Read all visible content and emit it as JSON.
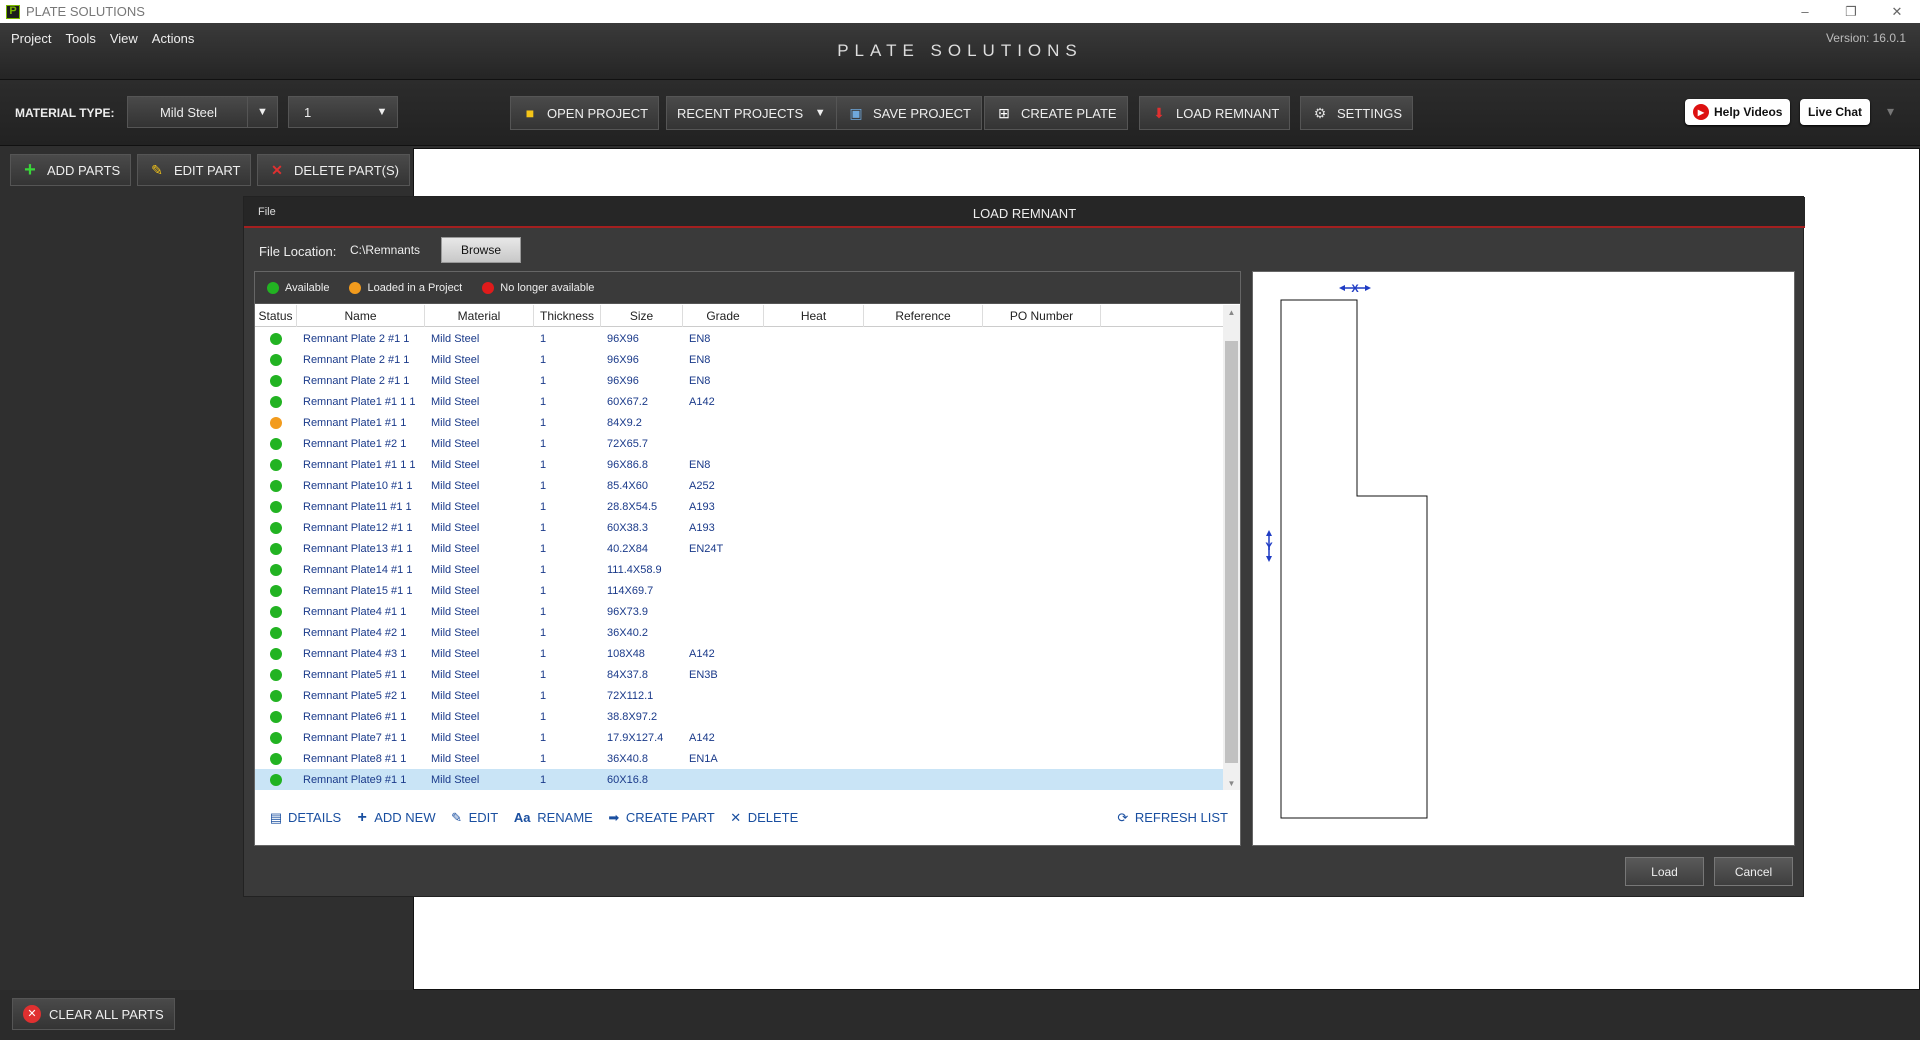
{
  "window": {
    "title": "PLATE SOLUTIONS",
    "controls": [
      "–",
      "❐",
      "✕"
    ]
  },
  "header": {
    "menu": [
      "Project",
      "Tools",
      "View",
      "Actions"
    ],
    "app_title": "PLATE SOLUTIONS",
    "version": "Version: 16.0.1"
  },
  "toolbar": {
    "material_type_label": "MATERIAL TYPE:",
    "material_value": "Mild Steel",
    "thickness_value": "1",
    "buttons": {
      "open_project": "OPEN PROJECT",
      "recent_projects": "RECENT PROJECTS",
      "save_project": "SAVE PROJECT",
      "create_plate": "CREATE PLATE",
      "load_remnant": "LOAD REMNANT",
      "settings": "SETTINGS"
    },
    "help_videos": "Help Videos",
    "live_chat": "Live Chat"
  },
  "left_panel": {
    "add_parts": "ADD PARTS",
    "edit_part": "EDIT PART",
    "delete_parts": "DELETE PART(S)",
    "clear_all_parts": "CLEAR ALL PARTS"
  },
  "dialog": {
    "menu_file": "File",
    "title": "LOAD REMNANT",
    "file_location_label": "File Location:",
    "file_location_value": "C:\\Remnants",
    "browse": "Browse",
    "legend": {
      "available": "Available",
      "loaded": "Loaded in a Project",
      "unavailable": "No longer available"
    },
    "colors": {
      "available": "#22b322",
      "loaded": "#f29b1d",
      "unavailable": "#e01b1b"
    },
    "columns": [
      "Status",
      "Name",
      "Material",
      "Thickness",
      "Size",
      "Grade",
      "Heat",
      "Reference",
      "PO Number"
    ],
    "rows": [
      {
        "status": "available",
        "name": "Remnant Plate 2 #1 1",
        "material": "Mild Steel",
        "thickness": "1",
        "size": "96X96",
        "grade": "EN8",
        "heat": "",
        "reference": "",
        "po": ""
      },
      {
        "status": "available",
        "name": "Remnant Plate 2 #1 1",
        "material": "Mild Steel",
        "thickness": "1",
        "size": "96X96",
        "grade": "EN8",
        "heat": "",
        "reference": "",
        "po": ""
      },
      {
        "status": "available",
        "name": "Remnant Plate 2 #1 1",
        "material": "Mild Steel",
        "thickness": "1",
        "size": "96X96",
        "grade": "EN8",
        "heat": "",
        "reference": "",
        "po": ""
      },
      {
        "status": "available",
        "name": "Remnant Plate1 #1 1 1",
        "material": "Mild Steel",
        "thickness": "1",
        "size": "60X67.2",
        "grade": "A142",
        "heat": "",
        "reference": "",
        "po": ""
      },
      {
        "status": "loaded",
        "name": "Remnant Plate1 #1 1",
        "material": "Mild Steel",
        "thickness": "1",
        "size": "84X9.2",
        "grade": "",
        "heat": "",
        "reference": "",
        "po": ""
      },
      {
        "status": "available",
        "name": "Remnant Plate1 #2 1",
        "material": "Mild Steel",
        "thickness": "1",
        "size": "72X65.7",
        "grade": "",
        "heat": "",
        "reference": "",
        "po": ""
      },
      {
        "status": "available",
        "name": "Remnant Plate1 #1 1 1",
        "material": "Mild Steel",
        "thickness": "1",
        "size": "96X86.8",
        "grade": "EN8",
        "heat": "",
        "reference": "",
        "po": ""
      },
      {
        "status": "available",
        "name": "Remnant Plate10 #1 1",
        "material": "Mild Steel",
        "thickness": "1",
        "size": "85.4X60",
        "grade": "A252",
        "heat": "",
        "reference": "",
        "po": ""
      },
      {
        "status": "available",
        "name": "Remnant Plate11 #1 1",
        "material": "Mild Steel",
        "thickness": "1",
        "size": "28.8X54.5",
        "grade": "A193",
        "heat": "",
        "reference": "",
        "po": ""
      },
      {
        "status": "available",
        "name": "Remnant Plate12 #1 1",
        "material": "Mild Steel",
        "thickness": "1",
        "size": "60X38.3",
        "grade": "A193",
        "heat": "",
        "reference": "",
        "po": ""
      },
      {
        "status": "available",
        "name": "Remnant Plate13 #1 1",
        "material": "Mild Steel",
        "thickness": "1",
        "size": "40.2X84",
        "grade": "EN24T",
        "heat": "",
        "reference": "",
        "po": ""
      },
      {
        "status": "available",
        "name": "Remnant Plate14 #1 1",
        "material": "Mild Steel",
        "thickness": "1",
        "size": "111.4X58.9",
        "grade": "",
        "heat": "",
        "reference": "",
        "po": ""
      },
      {
        "status": "available",
        "name": "Remnant Plate15 #1 1",
        "material": "Mild Steel",
        "thickness": "1",
        "size": "114X69.7",
        "grade": "",
        "heat": "",
        "reference": "",
        "po": ""
      },
      {
        "status": "available",
        "name": "Remnant Plate4 #1 1",
        "material": "Mild Steel",
        "thickness": "1",
        "size": "96X73.9",
        "grade": "",
        "heat": "",
        "reference": "",
        "po": ""
      },
      {
        "status": "available",
        "name": "Remnant Plate4 #2 1",
        "material": "Mild Steel",
        "thickness": "1",
        "size": "36X40.2",
        "grade": "",
        "heat": "",
        "reference": "",
        "po": ""
      },
      {
        "status": "available",
        "name": "Remnant Plate4 #3 1",
        "material": "Mild Steel",
        "thickness": "1",
        "size": "108X48",
        "grade": "A142",
        "heat": "",
        "reference": "",
        "po": ""
      },
      {
        "status": "available",
        "name": "Remnant Plate5 #1 1",
        "material": "Mild Steel",
        "thickness": "1",
        "size": "84X37.8",
        "grade": "EN3B",
        "heat": "",
        "reference": "",
        "po": ""
      },
      {
        "status": "available",
        "name": "Remnant Plate5 #2 1",
        "material": "Mild Steel",
        "thickness": "1",
        "size": "72X112.1",
        "grade": "",
        "heat": "",
        "reference": "",
        "po": ""
      },
      {
        "status": "available",
        "name": "Remnant Plate6 #1 1",
        "material": "Mild Steel",
        "thickness": "1",
        "size": "38.8X97.2",
        "grade": "",
        "heat": "",
        "reference": "",
        "po": ""
      },
      {
        "status": "available",
        "name": "Remnant Plate7 #1 1",
        "material": "Mild Steel",
        "thickness": "1",
        "size": "17.9X127.4",
        "grade": "A142",
        "heat": "",
        "reference": "",
        "po": ""
      },
      {
        "status": "available",
        "name": "Remnant Plate8 #1 1",
        "material": "Mild Steel",
        "thickness": "1",
        "size": "36X40.8",
        "grade": "EN1A",
        "heat": "",
        "reference": "",
        "po": ""
      },
      {
        "status": "available",
        "name": "Remnant Plate9 #1 1",
        "material": "Mild Steel",
        "thickness": "1",
        "size": "60X16.8",
        "grade": "",
        "heat": "",
        "reference": "",
        "po": "",
        "selected": true
      }
    ],
    "actions": {
      "details": "DETAILS",
      "add_new": "ADD NEW",
      "edit": "EDIT",
      "rename": "RENAME",
      "create_part": "CREATE PART",
      "delete": "DELETE",
      "refresh": "REFRESH LIST"
    },
    "preview": {
      "x_marker": "X",
      "y_marker": "Y"
    },
    "load_button": "Load",
    "cancel_button": "Cancel"
  }
}
